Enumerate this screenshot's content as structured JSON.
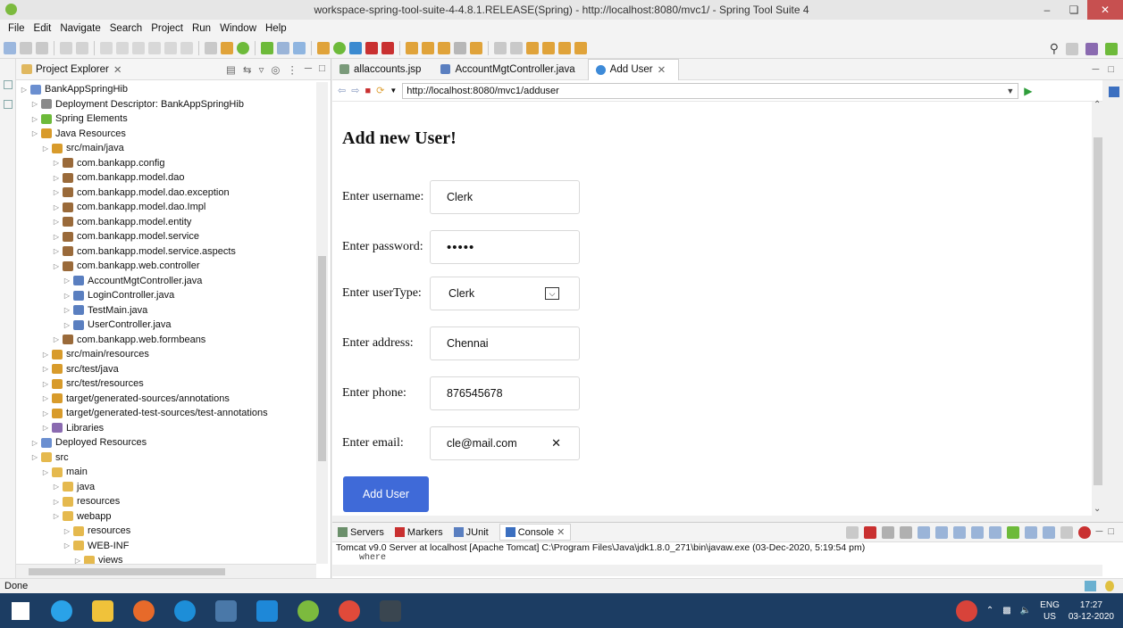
{
  "window": {
    "title": "workspace-spring-tool-suite-4-4.8.1.RELEASE(Spring) - http://localhost:8080/mvc1/ - Spring Tool Suite 4"
  },
  "menu": [
    "File",
    "Edit",
    "Navigate",
    "Search",
    "Project",
    "Run",
    "Window",
    "Help"
  ],
  "explorer": {
    "title": "Project Explorer",
    "items": [
      {
        "label": "BankAppSpringHib",
        "depth": 0,
        "icon": "project-icon",
        "color": "#6b8fd0"
      },
      {
        "label": "Deployment Descriptor: BankAppSpringHib",
        "depth": 1,
        "icon": "descriptor-icon",
        "color": "#8a8a8a"
      },
      {
        "label": "Spring Elements",
        "depth": 1,
        "icon": "spring-icon",
        "color": "#6dba3a"
      },
      {
        "label": "Java Resources",
        "depth": 1,
        "icon": "java-resources-icon",
        "color": "#d89b2b"
      },
      {
        "label": "src/main/java",
        "depth": 2,
        "icon": "source-folder-icon",
        "color": "#d89b2b"
      },
      {
        "label": "com.bankapp.config",
        "depth": 3,
        "icon": "package-icon",
        "color": "#9a6a3a"
      },
      {
        "label": "com.bankapp.model.dao",
        "depth": 3,
        "icon": "package-icon",
        "color": "#9a6a3a"
      },
      {
        "label": "com.bankapp.model.dao.exception",
        "depth": 3,
        "icon": "package-icon",
        "color": "#9a6a3a"
      },
      {
        "label": "com.bankapp.model.dao.Impl",
        "depth": 3,
        "icon": "package-icon",
        "color": "#9a6a3a"
      },
      {
        "label": "com.bankapp.model.entity",
        "depth": 3,
        "icon": "package-icon",
        "color": "#9a6a3a"
      },
      {
        "label": "com.bankapp.model.service",
        "depth": 3,
        "icon": "package-icon",
        "color": "#9a6a3a"
      },
      {
        "label": "com.bankapp.model.service.aspects",
        "depth": 3,
        "icon": "package-icon",
        "color": "#9a6a3a"
      },
      {
        "label": "com.bankapp.web.controller",
        "depth": 3,
        "icon": "package-icon",
        "color": "#9a6a3a"
      },
      {
        "label": "AccountMgtController.java",
        "depth": 4,
        "icon": "java-file-icon",
        "color": "#5a7fc0"
      },
      {
        "label": "LoginController.java",
        "depth": 4,
        "icon": "java-file-icon",
        "color": "#5a7fc0"
      },
      {
        "label": "TestMain.java",
        "depth": 4,
        "icon": "java-file-icon",
        "color": "#5a7fc0"
      },
      {
        "label": "UserController.java",
        "depth": 4,
        "icon": "java-file-icon",
        "color": "#5a7fc0"
      },
      {
        "label": "com.bankapp.web.formbeans",
        "depth": 3,
        "icon": "package-icon",
        "color": "#9a6a3a"
      },
      {
        "label": "src/main/resources",
        "depth": 2,
        "icon": "source-folder-icon",
        "color": "#d89b2b"
      },
      {
        "label": "src/test/java",
        "depth": 2,
        "icon": "source-folder-icon",
        "color": "#d89b2b"
      },
      {
        "label": "src/test/resources",
        "depth": 2,
        "icon": "source-folder-icon",
        "color": "#d89b2b"
      },
      {
        "label": "target/generated-sources/annotations",
        "depth": 2,
        "icon": "source-folder-icon",
        "color": "#d89b2b"
      },
      {
        "label": "target/generated-test-sources/test-annotations",
        "depth": 2,
        "icon": "source-folder-icon",
        "color": "#d89b2b"
      },
      {
        "label": "Libraries",
        "depth": 2,
        "icon": "libraries-icon",
        "color": "#8a6ab0"
      },
      {
        "label": "Deployed Resources",
        "depth": 1,
        "icon": "deployed-icon",
        "color": "#6b8fd0"
      },
      {
        "label": "src",
        "depth": 1,
        "icon": "folder-icon",
        "color": "#e5b94e"
      },
      {
        "label": "main",
        "depth": 2,
        "icon": "folder-icon",
        "color": "#e5b94e"
      },
      {
        "label": "java",
        "depth": 3,
        "icon": "folder-icon",
        "color": "#e5b94e"
      },
      {
        "label": "resources",
        "depth": 3,
        "icon": "folder-icon",
        "color": "#e5b94e"
      },
      {
        "label": "webapp",
        "depth": 3,
        "icon": "folder-icon",
        "color": "#e5b94e"
      },
      {
        "label": "resources",
        "depth": 4,
        "icon": "folder-icon",
        "color": "#e5b94e"
      },
      {
        "label": "WEB-INF",
        "depth": 4,
        "icon": "folder-icon",
        "color": "#e5b94e"
      },
      {
        "label": "views",
        "depth": 5,
        "icon": "folder-icon",
        "color": "#e5b94e"
      }
    ]
  },
  "editor_tabs": [
    {
      "label": "allaccounts.jsp",
      "active": false
    },
    {
      "label": "AccountMgtController.java",
      "active": false
    },
    {
      "label": "Add User",
      "active": true
    }
  ],
  "browser": {
    "url": "http://localhost:8080/mvc1/adduser"
  },
  "form": {
    "title": "Add new User!",
    "fields": [
      {
        "label": "Enter username:",
        "value": "Clerk",
        "kind": "text"
      },
      {
        "label": "Enter password:",
        "value": "•••••",
        "kind": "password"
      },
      {
        "label": "Enter userType:",
        "value": "Clerk",
        "kind": "select"
      },
      {
        "label": "Enter address:",
        "value": "Chennai",
        "kind": "text"
      },
      {
        "label": "Enter phone:",
        "value": "876545678",
        "kind": "text"
      },
      {
        "label": "Enter email:",
        "value": "cle@mail.com",
        "kind": "email"
      }
    ],
    "submit_label": "Add User"
  },
  "console": {
    "tabs": [
      "Servers",
      "Markers",
      "JUnit",
      "Console"
    ],
    "line": "Tomcat v9.0 Server at localhost [Apache Tomcat] C:\\Program Files\\Java\\jdk1.8.0_271\\bin\\javaw.exe  (03-Dec-2020, 5:19:54 pm)",
    "output": "where"
  },
  "status": "Done",
  "tray": {
    "lang": "ENG",
    "region": "US",
    "time": "17:27",
    "date": "03-12-2020"
  },
  "colors": {
    "accent": "#3f6ad8",
    "taskbar": "#1c3d63"
  }
}
